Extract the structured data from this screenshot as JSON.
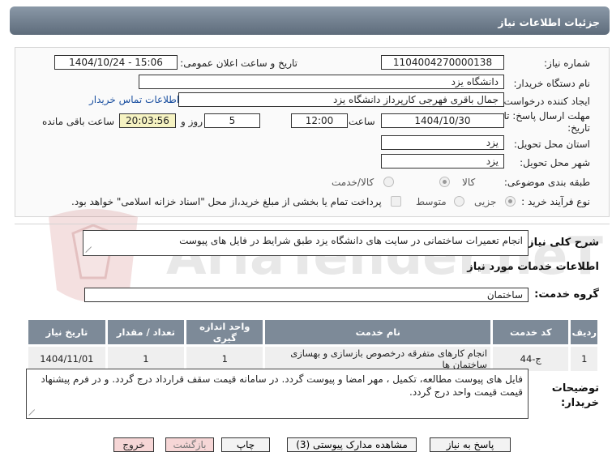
{
  "header": {
    "title": "جزئیات اطلاعات نیاز"
  },
  "form": {
    "need_number_label": "شماره نیاز:",
    "need_number": "1104004270000138",
    "announce_label": "تاریخ و ساعت اعلان عمومی:",
    "announce_value": "1404/10/24 - 15:06",
    "buyer_org_label": "نام دستگاه خریدار:",
    "buyer_org": "دانشگاه یزد",
    "creator_label": "ایجاد کننده درخواست:",
    "creator": "جمال باقری فهرجی کارپرداز دانشگاه یزد",
    "contact_link": "اطلاعات تماس خریدار",
    "deadline_label_1": "مهلت ارسال پاسخ: تا",
    "deadline_label_2": "تاریخ:",
    "deadline_date": "1404/10/30",
    "time_label": "ساعت",
    "deadline_time": "12:00",
    "days": "5",
    "day_and_label": "روز و",
    "remaining": "20:03:56",
    "remaining_label": "ساعت باقی مانده",
    "province_label": "استان محل تحویل:",
    "province": "یزد",
    "city_label": "شهر محل تحویل:",
    "city": "یزد",
    "category_label": "طبقه بندی موضوعی:",
    "category_options": [
      "کالا",
      "کالا/خدمت"
    ],
    "purchase_type_label": "نوع فرآیند خرید :",
    "purchase_options": [
      "جزیی",
      "متوسط"
    ],
    "payment_note": "پرداخت تمام یا بخشی از مبلغ خرید،از محل \"اسناد خزانه اسلامی\" خواهد بود."
  },
  "summary": {
    "label": "شرح کلی نیاز:",
    "text": "انجام تعمیرات ساختمانی در سایت های دانشگاه یزد طبق شرایط در فایل های پیوست"
  },
  "services": {
    "section_title": "اطلاعات خدمات مورد نیاز",
    "group_label": "گروه خدمت:",
    "group_value": "ساختمان"
  },
  "table": {
    "headers": [
      "ردیف",
      "کد خدمت",
      "نام خدمت",
      "واحد اندازه گیری",
      "تعداد / مقدار",
      "تاریخ نیاز"
    ],
    "rows": [
      [
        "1",
        "ج-44",
        "انجام کارهای متفرقه درخصوص بازسازی و بهسازی ساختمان ها",
        "1",
        "1",
        "1404/11/01"
      ]
    ]
  },
  "buyer_notes": {
    "label_1": "توضیحات",
    "label_2": "خریدار:",
    "text": "فایل های پیوست مطالعه، تکمیل ، مهر امضا و پیوست گردد. در سامانه قیمت سقف قرارداد درج گردد. و در فرم پیشنهاد قیمت قیمت واحد درج گردد."
  },
  "buttons": {
    "respond": "پاسخ به نیاز",
    "attachments": "مشاهده مدارک پیوستی (3)",
    "print": "چاپ",
    "back": "بازگشت",
    "exit": "خروج"
  },
  "colors": {
    "header_bg": "#6f7d8c",
    "table_header_bg": "#7d8a98",
    "remaining_bg": "#f6f3c2",
    "link": "#1a4fa0",
    "pink_button": "#f6d6d6"
  }
}
